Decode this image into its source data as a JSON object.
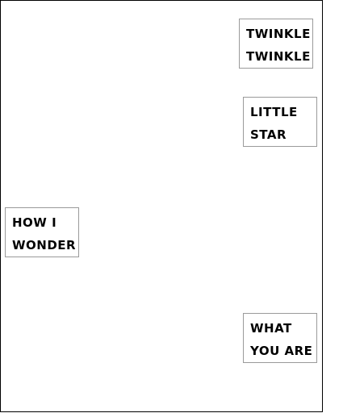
{
  "cards": [
    {
      "lines": [
        "TWINKLE",
        "TWINKLE"
      ]
    },
    {
      "lines": [
        "LITTLE",
        "STAR"
      ]
    },
    {
      "lines": [
        "HOW I",
        "WONDER"
      ]
    },
    {
      "lines": [
        "WHAT",
        "YOU ARE"
      ]
    }
  ]
}
